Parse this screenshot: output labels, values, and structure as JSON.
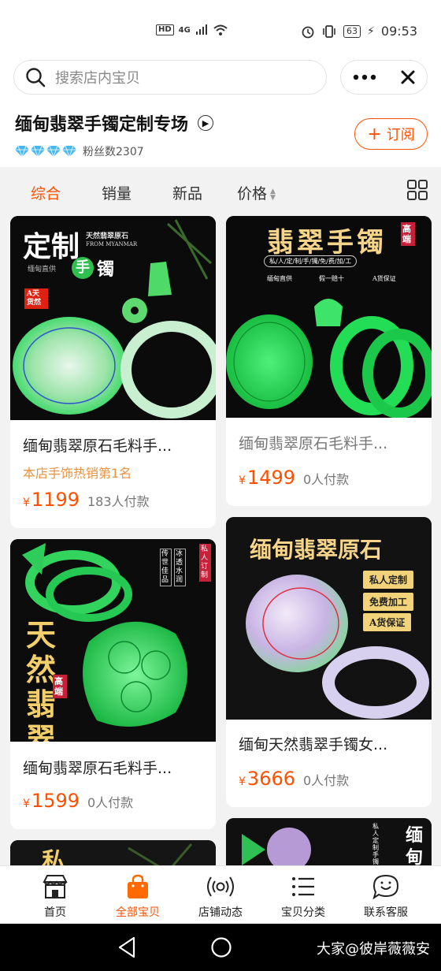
{
  "status": {
    "network": "4G",
    "hd": "HD",
    "battery": "63",
    "time": "09:53"
  },
  "search": {
    "placeholder": "搜索店内宝贝"
  },
  "shop": {
    "title": "缅甸翡翠手镯定制专场",
    "fans": "粉丝数2307",
    "diamond_count": 4,
    "subscribe_label": "订阅"
  },
  "sort": {
    "items": [
      "综合",
      "销量",
      "新品",
      "价格"
    ]
  },
  "products": [
    {
      "name": "缅甸翡翠原石毛料手...",
      "tag": "本店手饰热销第1名",
      "price": "1199",
      "sold": "183人付款",
      "img_text": {
        "big": "定制",
        "small1": "天然翡翠原石",
        "small2": "FROM MYANMAR",
        "small3": "缅甸直供",
        "small4": "手",
        "small5": "镯",
        "badge": "A天货然"
      }
    },
    {
      "name": "缅甸翡翠原石毛料手...",
      "price": "1499",
      "sold": "0人付款",
      "img_text": {
        "big": "翡翠手镯",
        "side": "高端",
        "line": "私/人/定/制/手/镯/免/费/加/工",
        "f1": "缅甸直供",
        "f2": "假一赔十",
        "f3": "A货保证"
      }
    },
    {
      "name": "缅甸翡翠原石毛料手...",
      "price": "1599",
      "sold": "0人付款",
      "img_text": {
        "big": "天然翡翠",
        "side": "高端",
        "v1": "传世佳品",
        "v2": "冰透水润",
        "v3": "私人订制"
      }
    },
    {
      "name": "缅甸天然翡翠手镯女...",
      "price": "3666",
      "sold": "0人付款",
      "img_text": {
        "big": "缅甸翡翠原石",
        "b1": "私人定制",
        "b2": "免费加工",
        "b3": "A货保证"
      }
    },
    {
      "img_text": {
        "big": "私"
      }
    },
    {
      "img_text": {
        "big": "缅甸",
        "side": "私人定制手镯"
      }
    }
  ],
  "tabs": [
    "首页",
    "全部宝贝",
    "店铺动态",
    "宝贝分类",
    "联系客服"
  ],
  "watermark": "大家@彼岸薇薇安",
  "colors": {
    "accent": "#ff5000",
    "tag": "#e89340",
    "jade": "#2fd860"
  }
}
